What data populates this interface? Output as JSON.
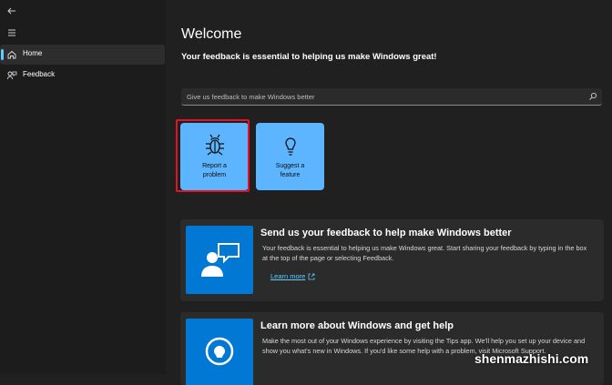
{
  "sidebar": {
    "items": [
      {
        "label": "Home",
        "icon": "home-icon",
        "selected": true
      },
      {
        "label": "Feedback",
        "icon": "feedback-icon",
        "selected": false
      }
    ]
  },
  "main": {
    "title": "Welcome",
    "subtitle": "Your feedback is essential to helping us make Windows great!",
    "search": {
      "placeholder": "Give us feedback to make Windows better"
    },
    "tiles": [
      {
        "label": "Report a\nproblem",
        "icon": "bug-icon"
      },
      {
        "label": "Suggest a\nfeature",
        "icon": "lightbulb-icon"
      }
    ],
    "cards": [
      {
        "title": "Send us your feedback to help make Windows better",
        "body": "Your feedback is essential to helping us make Windows great. Start sharing your feedback by typing in the box at the top of the page or selecting Feedback.",
        "link": "Learn more"
      },
      {
        "title": "Learn more about Windows and get help",
        "body": "Make the most out of your Windows experience by visiting the Tips app. We'll help you set up your device and show you what's new in Windows. If you'd like some help with a problem, visit Microsoft Support."
      }
    ]
  },
  "watermark": "shenmazhishi.com",
  "colors": {
    "accent": "#60cdff",
    "tile": "#5db4ff",
    "card_image": "#0078d4",
    "highlight": "#e81123"
  }
}
